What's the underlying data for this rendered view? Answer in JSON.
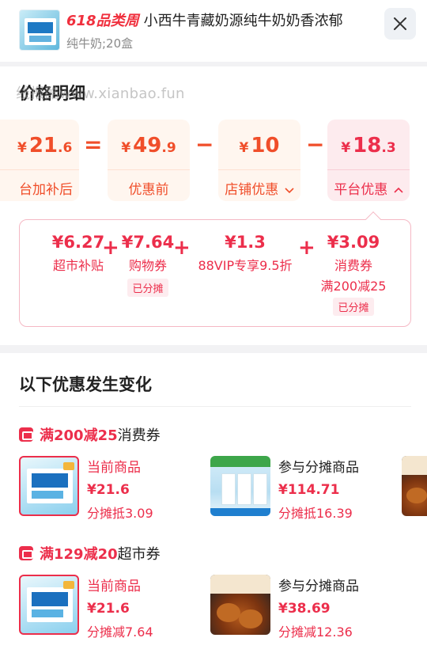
{
  "header": {
    "brand_tag": "618品类周",
    "title": "小西牛青藏奶源纯牛奶奶香浓郁",
    "subtitle": "纯牛奶;20盒"
  },
  "watermark": "线报酷www.xianbao.fun",
  "price_section": {
    "title": "价格明细",
    "boxes": [
      {
        "currency": "¥",
        "int": "21",
        "dec": ".6",
        "label": "台加补后"
      },
      {
        "currency": "¥",
        "int": "49",
        "dec": ".9",
        "label": "优惠前"
      },
      {
        "currency": "¥",
        "int": "10",
        "dec": "",
        "label": "店铺优惠"
      },
      {
        "currency": "¥",
        "int": "18",
        "dec": ".3",
        "label": "平台优惠"
      }
    ],
    "operators": {
      "eq": "=",
      "minus1": "−",
      "minus2": "−"
    },
    "details": [
      {
        "value": "¥6.27",
        "name": "超市补贴"
      },
      {
        "value": "¥7.64",
        "name": "购物券",
        "tag": "已分摊"
      },
      {
        "value": "¥1.3",
        "name": "88VIP专享9.5折"
      },
      {
        "value": "¥3.09",
        "name": "消费券",
        "name2": "满200减25",
        "tag": "已分摊"
      }
    ],
    "plus": "+"
  },
  "changes": {
    "title": "以下优惠发生变化",
    "coupons": [
      {
        "red": "满200减25",
        "rest": "消费券",
        "items": [
          {
            "l1": "当前商品",
            "l2": "¥21.6",
            "l3": "分摊抵3.09"
          },
          {
            "l1": "参与分摊商品",
            "l2": "¥114.71",
            "l3": "分摊抵16.39"
          }
        ]
      },
      {
        "red": "满129减20",
        "rest": "超市券",
        "items": [
          {
            "l1": "当前商品",
            "l2": "¥21.6",
            "l3": "分摊减7.64"
          },
          {
            "l1": "参与分摊商品",
            "l2": "¥38.69",
            "l3": "分摊减12.36"
          }
        ]
      }
    ]
  },
  "colors": {
    "accent_red": "#ec2e4b",
    "accent_orange": "#f04e2a"
  },
  "icons": [
    "close-icon",
    "chevron-down-icon",
    "chevron-up-icon",
    "coupon-icon"
  ]
}
